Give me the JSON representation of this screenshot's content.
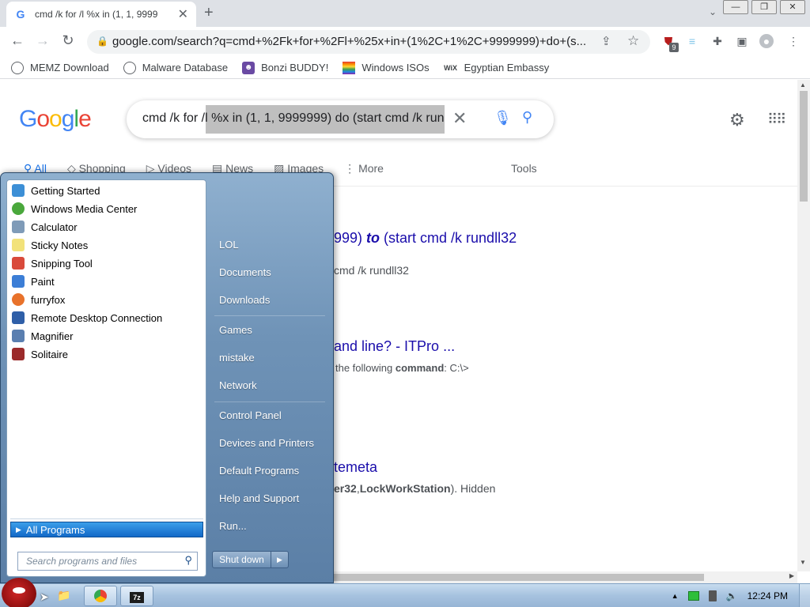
{
  "browser": {
    "tab_title": "cmd /k for /l %x in (1, 1, 9999",
    "tab_favicon": "G",
    "url": "google.com/search?q=cmd+%2Fk+for+%2Fl+%25x+in+(1%2C+1%2C+9999999)+do+(s...",
    "ext_badge": "9",
    "bookmarks": [
      {
        "label": "MEMZ Download",
        "icon": "globe-icon"
      },
      {
        "label": "Malware Database",
        "icon": "globe-icon"
      },
      {
        "label": "Bonzi BUDDY!",
        "icon": "bonzi-icon"
      },
      {
        "label": "Windows ISOs",
        "icon": "rainbow-icon"
      },
      {
        "label": "Egyptian Embassy",
        "icon": "wix-icon"
      }
    ]
  },
  "google": {
    "logo": "Google",
    "query": "cmd /k for /l %x in (1, 1, 9999999) do (start cmd /k run",
    "filters": [
      "All",
      "Shopping",
      "Videos",
      "News",
      "Images",
      "More"
    ],
    "tools": "Tools",
    "results": [
      {
        "title_pre": "999) ",
        "title_em": "to",
        "title_post": " (start cmd /k rundll32",
        "snippet": "cmd /k rundll32"
      },
      {
        "title": "and line? - ITPro ...",
        "snippet_pre": "the following ",
        "snippet_bold": "command",
        "snippet_post": ": C:\\>"
      },
      {
        "title": "temeta",
        "snippet_bold1": "er32",
        "snippet_mid": ",",
        "snippet_bold2": "LockWorkStation",
        "snippet_post": "). Hidden"
      }
    ]
  },
  "startmenu": {
    "programs": [
      {
        "label": "Getting Started",
        "color": "#3c8fd6"
      },
      {
        "label": "Windows Media Center",
        "color": "#4aa83c"
      },
      {
        "label": "Calculator",
        "color": "#7f9bb8"
      },
      {
        "label": "Sticky Notes",
        "color": "#f2e27a"
      },
      {
        "label": "Snipping Tool",
        "color": "#d94a3b"
      },
      {
        "label": "Paint",
        "color": "#3c7ed6"
      },
      {
        "label": "furryfox",
        "color": "#e8722b"
      },
      {
        "label": "Remote Desktop Connection",
        "color": "#2f5fa8"
      },
      {
        "label": "Magnifier",
        "color": "#5a7fb0"
      },
      {
        "label": "Solitaire",
        "color": "#9b2b2b"
      }
    ],
    "all_programs": "All Programs",
    "search_placeholder": "Search programs and files",
    "right_links": [
      "LOL",
      "Documents",
      "Downloads",
      "Games",
      "mistake",
      "Network",
      "Control Panel",
      "Devices and Printers",
      "Default Programs",
      "Help and Support",
      "Run..."
    ],
    "shutdown": "Shut down"
  },
  "taskbar": {
    "clock": "12:24 PM"
  }
}
